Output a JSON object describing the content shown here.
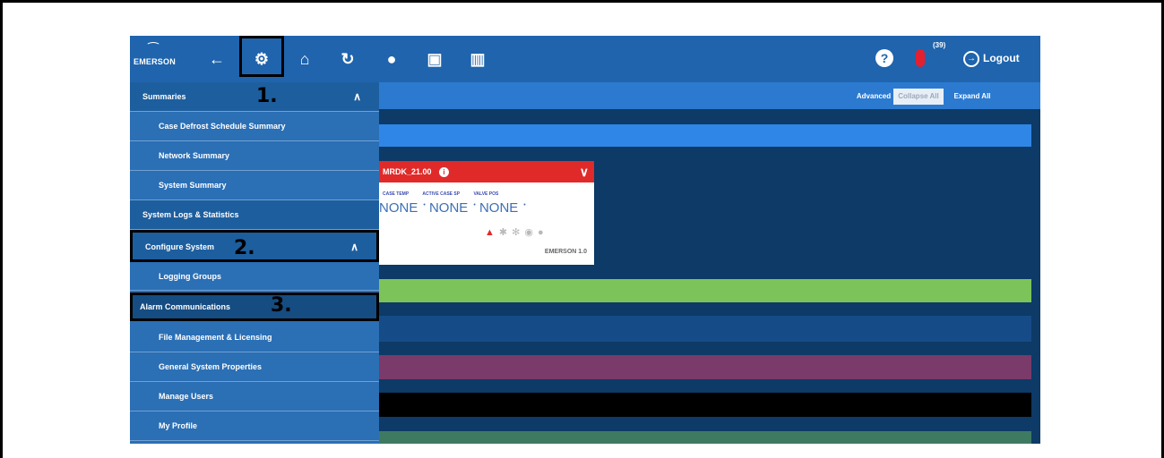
{
  "logo": {
    "text": "EMERSON"
  },
  "topbar": {
    "icons": [
      "back-arrow-icon",
      "gear-icon",
      "home-icon",
      "refresh-icon",
      "globe-icon",
      "calendar-icon",
      "book-icon"
    ],
    "help_icon": "?",
    "notification_count": "(39)",
    "logout_label": "Logout"
  },
  "sidebar": {
    "summaries": "Summaries",
    "case_defrost": "Case Defrost Schedule Summary",
    "network_summary": "Network Summary",
    "system_summary": "System Summary",
    "system_logs": "System Logs & Statistics",
    "configure_system": "Configure System",
    "logging_groups": "Logging Groups",
    "alarm_communications": "Alarm Communications",
    "file_management": "File Management & Licensing",
    "general_properties": "General System Properties",
    "manage_users": "Manage Users",
    "my_profile": "My Profile"
  },
  "callouts": {
    "one": "1.",
    "two": "2.",
    "three": "3."
  },
  "toolbar": {
    "advanced": "Advanced",
    "collapse_all": "Collapse All",
    "expand_all": "Expand All"
  },
  "card": {
    "title": "MRDK_21.00",
    "labels": [
      "CASE TEMP",
      "ACTIVE CASE SP",
      "VALVE POS"
    ],
    "values": [
      "NONE",
      "NONE",
      "NONE"
    ],
    "footer": "EMERSON 1.0"
  },
  "colors": {
    "blue_bar": "#2f86e6",
    "green_bar": "#7cc35a",
    "navy_bar": "#154c87",
    "purple_bar": "#7a3a6a",
    "black_bar": "#000000",
    "teal_bar": "#3e7a62"
  }
}
